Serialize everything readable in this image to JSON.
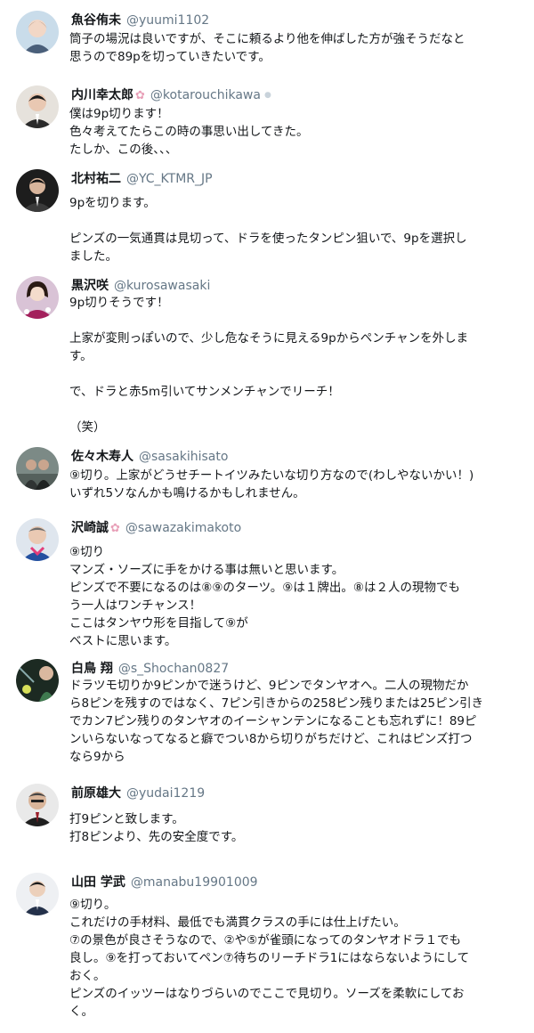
{
  "posts": [
    {
      "name": "魚谷侑未",
      "handle": "@yuumi1102",
      "badge": "",
      "avatar": {
        "bg": "#c9dcea",
        "fg": "#4a5f7a",
        "skin": "#f2d7c6"
      },
      "text": "筒子の場況は良いですが、そこに頼るより他を伸ばした方が強そうだなと\n思うので89pを切っていきたいです。"
    },
    {
      "name": "内川幸太郎",
      "handle": "@kotarouchikawa",
      "badge": "flower",
      "avatar": {
        "bg": "#e6e2dc",
        "fg": "#2a2a2a",
        "skin": "#e9c8b2"
      },
      "text": "僕は9p切ります！\n色々考えてたらこの時の事思い出してきた。\nたしか、この後、、、"
    },
    {
      "name": "北村祐二",
      "handle": "@YC_KTMR_JP",
      "badge": "",
      "avatar": {
        "bg": "#1d1d1d",
        "fg": "#2c2c2c",
        "skin": "#d8b59c"
      },
      "text": "9pを切ります。\n\nピンズの一気通貫は見切って、ドラを使ったタンピン狙いで、9pを選択し\nました。"
    },
    {
      "name": "黒沢咲",
      "handle": "@kurosawasaki",
      "badge": "",
      "avatar": {
        "bg": "#d9c3d6",
        "fg": "#a3205c",
        "skin": "#f4dccc"
      },
      "text": "9p切りそうです！\n\n上家が変則っぽいので、少し危なそうに見える9pからペンチャンを外しま\nす。\n\nで、ドラと赤5m引いてサンメンチャンでリーチ！\n\n（笑）"
    },
    {
      "name": "佐々木寿人",
      "handle": "@sasakihisato",
      "badge": "",
      "avatar": {
        "bg": "#7c8a86",
        "fg": "#2f3433",
        "skin": "#c9a58e"
      },
      "text": "⑨切り。上家がどうせチートイツみたいな切り方なので(わしやないかい！)\nいずれ5ソなんかも鳴けるかもしれません。"
    },
    {
      "name": "沢崎誠",
      "handle": "@sawazakimakoto",
      "badge": "flower",
      "avatar": {
        "bg": "#dfe6ee",
        "fg": "#2350a0",
        "skin": "#eac9b3"
      },
      "text": "⑨切り\nマンズ・ソーズに手をかける事は無いと思います。\nピンズで不要になるのは⑧⑨のターツ。⑨は１牌出。⑧は２人の現物でも\nう一人はワンチャンス！\nここはタンヤウ形を目指して⑨が\nベストに思います。"
    },
    {
      "name": "白鳥 翔",
      "handle": "@s_Shochan0827",
      "badge": "",
      "avatar": {
        "bg": "#1c2a22",
        "fg": "#3f7a4f",
        "skin": "#d9b89f"
      },
      "text": "ドラツモ切りか9ピンかで迷うけど、9ピンでタンヤオへ。二人の現物だか\nら8ピンを残すのではなく、7ピン引きからの258ピン残りまたは25ピン引き\nでカン7ピン残りのタンヤオのイーシャンテンになることも忘れずに！89ピ\nンいらないなってなると癖でつい8から切りがちだけど、これはピンズ打つ\nなら9から"
    },
    {
      "name": "前原雄大",
      "handle": "@yudai1219",
      "badge": "",
      "avatar": {
        "bg": "#e9e9e9",
        "fg": "#1f1f1f",
        "skin": "#d9b59a"
      },
      "text": "打9ピンと致します。\n打8ピンより、先の安全度です。"
    },
    {
      "name": "山田 学武",
      "handle": "@manabu19901009",
      "badge": "",
      "avatar": {
        "bg": "#eef0f3",
        "fg": "#24314a",
        "skin": "#ecd0bb"
      },
      "text": "⑨切り。\nこれだけの手材料、最低でも満貫クラスの手には仕上げたい。\n⑦の景色が良さそうなので、②や⑤が雀頭になってのタンヤオドラ１でも\n良し。⑨を打っておいてペン⑦待ちのリーチドラ1にはならないようにして\nおく。\nピンズのイッツーはなりづらいのでここで見切り。ソーズを柔軟にしてお\nく。"
    }
  ]
}
